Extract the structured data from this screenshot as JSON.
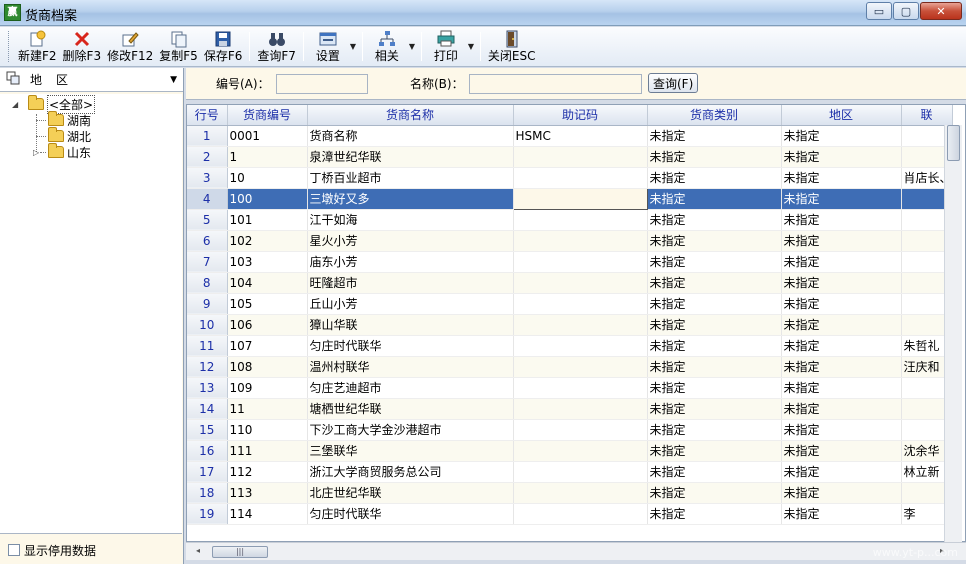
{
  "window": {
    "title": "货商档案",
    "app_icon_text": "赢",
    "min_symbol": "▭",
    "max_symbol": "▢",
    "close_symbol": "✕"
  },
  "toolbar": {
    "items": [
      {
        "label": "新建F2",
        "icon": "new-icon"
      },
      {
        "label": "删除F3",
        "icon": "delete-icon"
      },
      {
        "label": "修改F12",
        "icon": "edit-icon"
      },
      {
        "label": "复制F5",
        "icon": "copy-icon"
      },
      {
        "label": "保存F6",
        "icon": "save-icon"
      },
      {
        "label": "查询F7",
        "icon": "binoculars-icon"
      },
      {
        "label": "设置",
        "icon": "settings-icon"
      },
      {
        "label": "相关",
        "icon": "related-icon"
      },
      {
        "label": "打印",
        "icon": "printer-icon"
      },
      {
        "label": "关闭ESC",
        "icon": "exit-door-icon"
      }
    ],
    "dropdown_arrow": "▼"
  },
  "left": {
    "header_label": "地区",
    "dropdown_arrow": "▼",
    "tree": {
      "root": "<全部>",
      "children": [
        "湖南",
        "湖北",
        "山东"
      ]
    },
    "show_disabled_label": "显示停用数据"
  },
  "search": {
    "code_label": "编号(A)：",
    "code_value": "",
    "name_label": "名称(B)：",
    "name_value": "",
    "button_label": "查询(F)"
  },
  "grid": {
    "columns": [
      "行号",
      "货商编号",
      "货商名称",
      "助记码",
      "货商类别",
      "地区",
      "联"
    ],
    "rows": [
      [
        "1",
        "0001",
        "货商名称",
        "HSMC",
        "未指定",
        "未指定",
        ""
      ],
      [
        "2",
        "1",
        "泉漳世纪华联",
        "",
        "未指定",
        "未指定",
        ""
      ],
      [
        "3",
        "10",
        "丁桥百业超市",
        "",
        "未指定",
        "未指定",
        "肖店长、"
      ],
      [
        "4",
        "100",
        "三墩好又多",
        "",
        "未指定",
        "未指定",
        ""
      ],
      [
        "5",
        "101",
        "江干如海",
        "",
        "未指定",
        "未指定",
        ""
      ],
      [
        "6",
        "102",
        "星火小芳",
        "",
        "未指定",
        "未指定",
        ""
      ],
      [
        "7",
        "103",
        "庙东小芳",
        "",
        "未指定",
        "未指定",
        ""
      ],
      [
        "8",
        "104",
        "旺隆超市",
        "",
        "未指定",
        "未指定",
        ""
      ],
      [
        "9",
        "105",
        "丘山小芳",
        "",
        "未指定",
        "未指定",
        ""
      ],
      [
        "10",
        "106",
        "獐山华联",
        "",
        "未指定",
        "未指定",
        ""
      ],
      [
        "11",
        "107",
        "匀庄时代联华",
        "",
        "未指定",
        "未指定",
        "朱哲礼"
      ],
      [
        "12",
        "108",
        "温州村联华",
        "",
        "未指定",
        "未指定",
        "汪庆和"
      ],
      [
        "13",
        "109",
        "匀庄艺迪超市",
        "",
        "未指定",
        "未指定",
        ""
      ],
      [
        "14",
        "11",
        "塘栖世纪华联",
        "",
        "未指定",
        "未指定",
        ""
      ],
      [
        "15",
        "110",
        "下沙工商大学金沙港超市",
        "",
        "未指定",
        "未指定",
        ""
      ],
      [
        "16",
        "111",
        "三堡联华",
        "",
        "未指定",
        "未指定",
        "沈余华"
      ],
      [
        "17",
        "112",
        "浙江大学商贸服务总公司",
        "",
        "未指定",
        "未指定",
        "林立新"
      ],
      [
        "18",
        "113",
        "北庄世纪华联",
        "",
        "未指定",
        "未指定",
        ""
      ],
      [
        "19",
        "114",
        "匀庄时代联华",
        "",
        "未指定",
        "未指定",
        "李"
      ]
    ],
    "selected_row": 4
  },
  "scroll": {
    "left_arrow": "◂",
    "right_arrow": "▸",
    "up_arrow": "▴",
    "down_arrow": "▾",
    "thumb_grip": "|||"
  },
  "watermark": "www.yt-p...com"
}
